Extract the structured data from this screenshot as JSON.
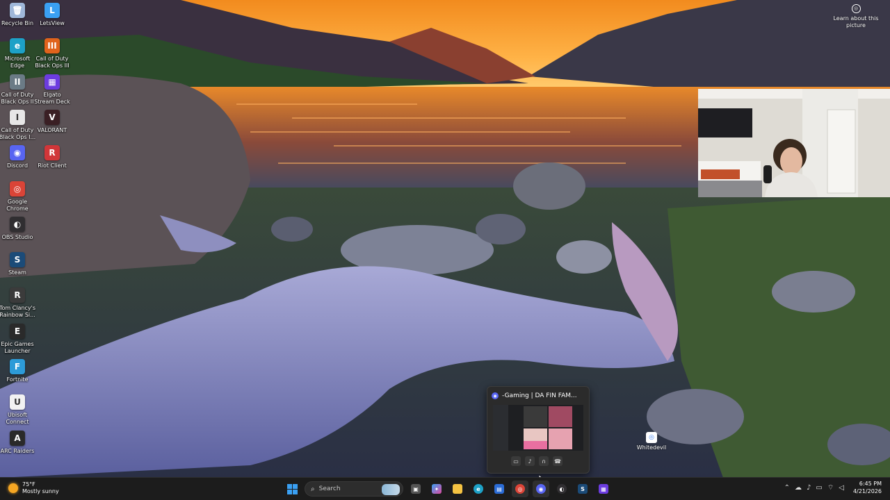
{
  "desktop": {
    "icons_col1": [
      {
        "label": "Recycle Bin",
        "icon": "recycle-bin-icon",
        "color": "#9fb7d9",
        "glyph": "🗑"
      },
      {
        "label": "Microsoft Edge",
        "icon": "edge-icon",
        "color": "#1da1c7",
        "glyph": "e"
      },
      {
        "label": "Call of Duty Black Ops II",
        "icon": "cod-bo2-icon",
        "color": "#6b7b86",
        "glyph": "II"
      },
      {
        "label": "Call of Duty Black Ops I...",
        "icon": "cod-bo1-icon",
        "color": "#e7e7e7",
        "glyph": "I"
      },
      {
        "label": "Discord",
        "icon": "discord-icon",
        "color": "#5865F2",
        "glyph": "◉"
      },
      {
        "label": "Google Chrome",
        "icon": "chrome-icon",
        "color": "#db4437",
        "glyph": "◎"
      },
      {
        "label": "OBS Studio",
        "icon": "obs-icon",
        "color": "#302e31",
        "glyph": "◐"
      },
      {
        "label": "Steam",
        "icon": "steam-icon",
        "color": "#1b4b78",
        "glyph": "S"
      },
      {
        "label": "Tom Clancy's Rainbow Si...",
        "icon": "rainbow-six-icon",
        "color": "#3b3b3b",
        "glyph": "R"
      },
      {
        "label": "Epic Games Launcher",
        "icon": "epic-games-icon",
        "color": "#2a2a2a",
        "glyph": "E"
      },
      {
        "label": "Fortnite",
        "icon": "fortnite-icon",
        "color": "#2d9bd8",
        "glyph": "F"
      },
      {
        "label": "Ubisoft Connect",
        "icon": "ubisoft-icon",
        "color": "#f2f2f2",
        "glyph": "U"
      },
      {
        "label": "ARC Raiders",
        "icon": "arc-raiders-icon",
        "color": "#2a2a2a",
        "glyph": "A"
      }
    ],
    "icons_col2": [
      {
        "label": "LetsView",
        "icon": "letsview-icon",
        "color": "#3aa0f3",
        "glyph": "L"
      },
      {
        "label": "Call of Duty Black Ops III",
        "icon": "cod-bo3-icon",
        "color": "#e0631c",
        "glyph": "III"
      },
      {
        "label": "Elgato Stream Deck",
        "icon": "stream-deck-icon",
        "color": "#6c3ce0",
        "glyph": "▦"
      },
      {
        "label": "VALORANT",
        "icon": "valorant-icon",
        "color": "#3a1f24",
        "glyph": "V"
      },
      {
        "label": "Riot Client",
        "icon": "riot-client-icon",
        "color": "#d13639",
        "glyph": "R"
      }
    ],
    "learn_more": "Learn about this picture",
    "stray_icon_label": "Whitedevil"
  },
  "preview": {
    "title": "-Gaming | DA FIN FAM...",
    "controls": [
      "camera-icon",
      "mic-icon",
      "headphones-icon",
      "disconnect-icon"
    ]
  },
  "taskbar": {
    "weather_temp": "75°F",
    "weather_desc": "Mostly sunny",
    "search_placeholder": "Search",
    "time": "6:45 PM",
    "date": "4/21/2026"
  },
  "colors": {
    "taskbar_bg": "#1c1c1c",
    "accent": "#3aa0f3",
    "discord": "#5865F2"
  }
}
